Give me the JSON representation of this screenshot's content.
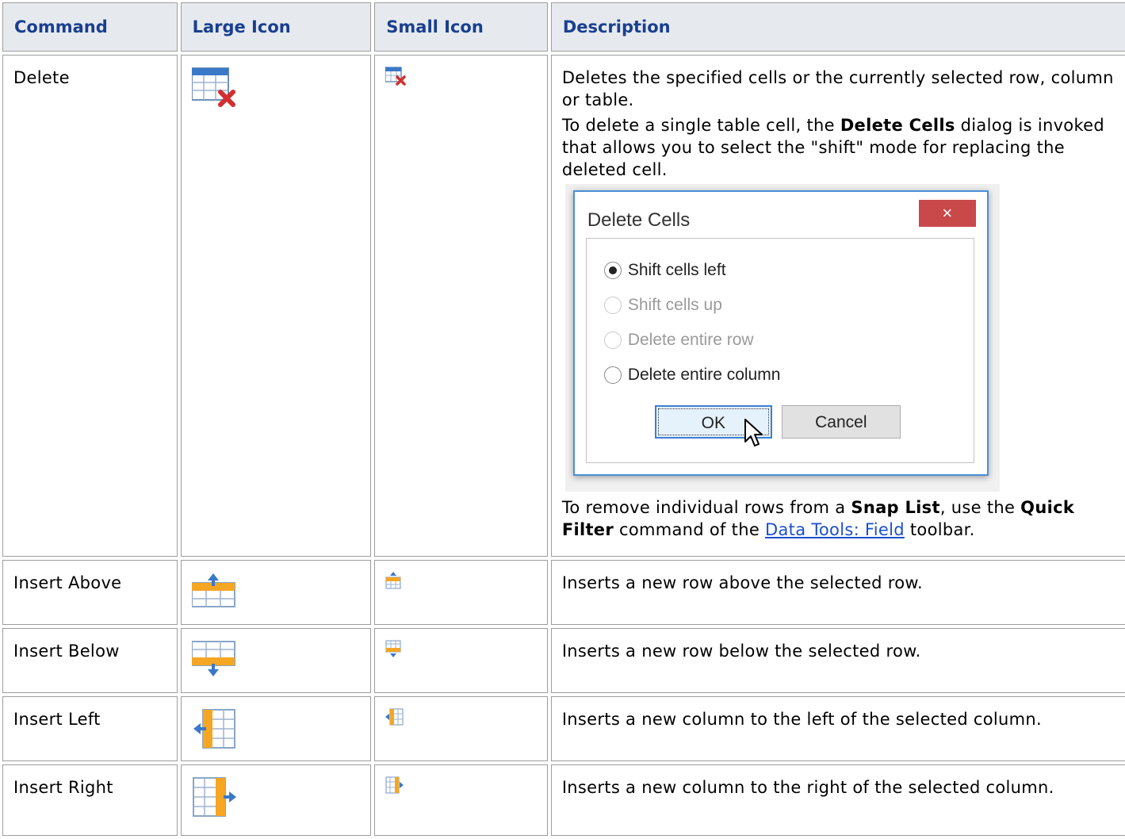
{
  "headers": {
    "command": "Command",
    "large_icon": "Large Icon",
    "small_icon": "Small Icon",
    "description": "Description"
  },
  "rows": [
    {
      "command": "Delete",
      "icon": "table-delete-icon",
      "desc_1": "Deletes the specified cells or the currently selected row, column or table.",
      "desc_2_pre": "To delete a single table cell, the ",
      "desc_2_bold": "Delete Cells",
      "desc_2_post": " dialog is invoked that allows you to select the \"shift\" mode for replacing the deleted cell.",
      "desc_3_pre": "To remove individual rows from a ",
      "desc_3_bold": "Snap List",
      "desc_3_mid": ", use the ",
      "desc_3_bold2": "Quick Filter",
      "desc_3_mid2": " command of the ",
      "desc_3_link": "Data Tools: Field",
      "desc_3_post": " toolbar."
    },
    {
      "command": "Insert Above",
      "icon": "insert-row-above-icon",
      "desc": "Inserts a new row above the selected row."
    },
    {
      "command": "Insert Below",
      "icon": "insert-row-below-icon",
      "desc": "Inserts a new row below the selected row."
    },
    {
      "command": "Insert Left",
      "icon": "insert-column-left-icon",
      "desc": "Inserts a new column to the left of the selected column."
    },
    {
      "command": "Insert Right",
      "icon": "insert-column-right-icon",
      "desc": "Inserts a new column to the right of the selected column."
    }
  ],
  "dialog": {
    "title": "Delete Cells",
    "close": "×",
    "options": [
      {
        "label": "Shift cells left",
        "checked": true,
        "disabled": false
      },
      {
        "label": "Shift cells up",
        "checked": false,
        "disabled": true
      },
      {
        "label": "Delete entire row",
        "checked": false,
        "disabled": true
      },
      {
        "label": "Delete entire column",
        "checked": false,
        "disabled": false
      }
    ],
    "ok": "OK",
    "cancel": "Cancel"
  },
  "colors": {
    "header_bg": "#e6eaef",
    "header_text": "#1a3f8f",
    "link": "#1a4fcc",
    "icon_orange": "#f5a623",
    "icon_blue": "#3a78c8",
    "delete_red": "#d22f2f"
  }
}
